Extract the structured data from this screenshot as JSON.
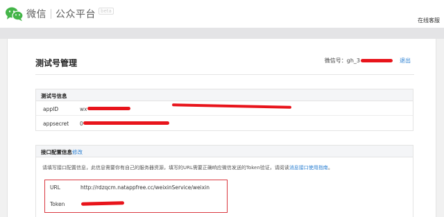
{
  "header": {
    "brand": "微信",
    "product": "公众平台",
    "beta": "beta",
    "help": "在线客服"
  },
  "page": {
    "title": "测试号管理",
    "account_label": "微信号：gh_3",
    "logout": "退出"
  },
  "test_account": {
    "heading": "测试号信息",
    "rows": [
      {
        "label": "appID",
        "value": "wx"
      },
      {
        "label": "appsecret",
        "value": "0"
      }
    ]
  },
  "interface_config": {
    "heading": "接口配置信息",
    "edit": "修改",
    "desc_text": "请填写接口配置信息，此信息需要你有自己的服务器资源，填写的URL需要正确响应微信发送的Token验证，请阅读",
    "desc_link": "消息接口使用指南",
    "desc_end": "。",
    "url_label": "URL",
    "url_value": "http://rdzqcm.natappfree.cc/weixinService/weixin",
    "token_label": "Token"
  },
  "colors": {
    "accent_link": "#2a7fd2",
    "redaction": "#e8141b",
    "highlight_border": "#d9363e",
    "wechat_green": "#44b549"
  }
}
